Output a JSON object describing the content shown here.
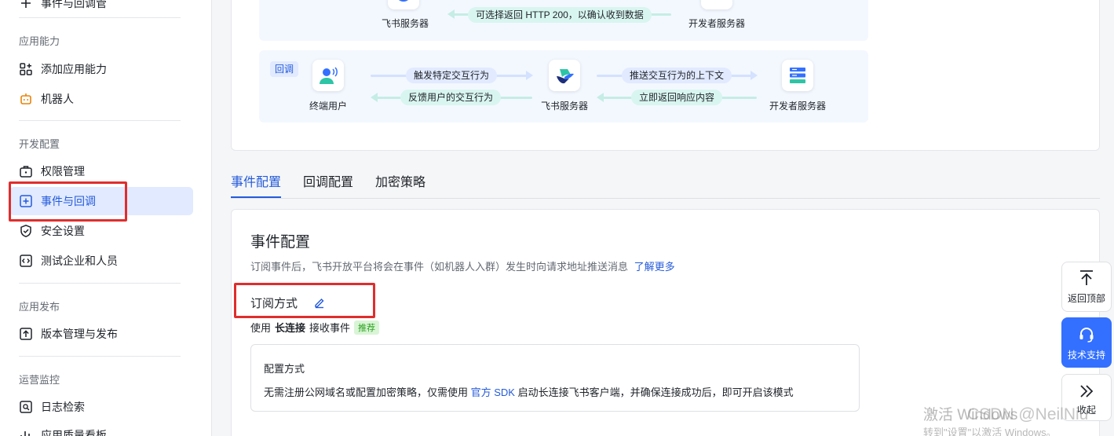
{
  "sidebar": {
    "top_item_label": "事件与回调管",
    "sections": [
      {
        "title": "应用能力",
        "items": [
          {
            "label": "添加应用能力"
          },
          {
            "label": "机器人"
          }
        ]
      },
      {
        "title": "开发配置",
        "items": [
          {
            "label": "权限管理"
          },
          {
            "label": "事件与回调"
          },
          {
            "label": "安全设置"
          },
          {
            "label": "测试企业和人员"
          }
        ]
      },
      {
        "title": "应用发布",
        "items": [
          {
            "label": "版本管理与发布"
          }
        ]
      },
      {
        "title": "运营监控",
        "items": [
          {
            "label": "日志检索"
          },
          {
            "label": "应用质量看板"
          }
        ]
      }
    ]
  },
  "diagram": {
    "top_flow": {
      "left_label": "飞书服务器",
      "right_label": "开发者服务器",
      "back_pill": "可选择返回 HTTP 200，以确认收到数据"
    },
    "callback_flow": {
      "tag": "回调",
      "user_label": "终端用户",
      "server_label": "飞书服务器",
      "dev_label": "开发者服务器",
      "pill_trigger": "触发特定交互行为",
      "pill_feedback": "反馈用户的交互行为",
      "pill_push": "推送交互行为的上下文",
      "pill_respond": "立即返回响应内容"
    }
  },
  "tabs": [
    {
      "label": "事件配置"
    },
    {
      "label": "回调配置"
    },
    {
      "label": "加密策略"
    }
  ],
  "event_config": {
    "title": "事件配置",
    "desc": "订阅事件后，飞书开放平台将会在事件（如机器人入群）发生时向请求地址推送消息",
    "learn_more": "了解更多",
    "sub_title": "订阅方式",
    "use_prefix": "使用",
    "use_bold": "长连接",
    "use_suffix": "接收事件",
    "badge": "推荐",
    "box_title": "配置方式",
    "box_text_prefix": "无需注册公网域名或配置加密策略，仅需使用",
    "box_link": "官方 SDK",
    "box_text_suffix": "启动长连接飞书客户端，并确保连接成功后，即可开启该模式"
  },
  "float_buttons": {
    "back_top": "返回顶部",
    "support": "技术支持",
    "collapse": "收起"
  },
  "watermark": {
    "line1": "激活 Windows",
    "line2": "转到\"设置\"以激活 Windows。",
    "csdn": "CSDN @NeilNiu"
  },
  "colors": {
    "accent": "#245bdb",
    "highlight_box": "#e02d2d",
    "badge_green": "#2ea121"
  }
}
